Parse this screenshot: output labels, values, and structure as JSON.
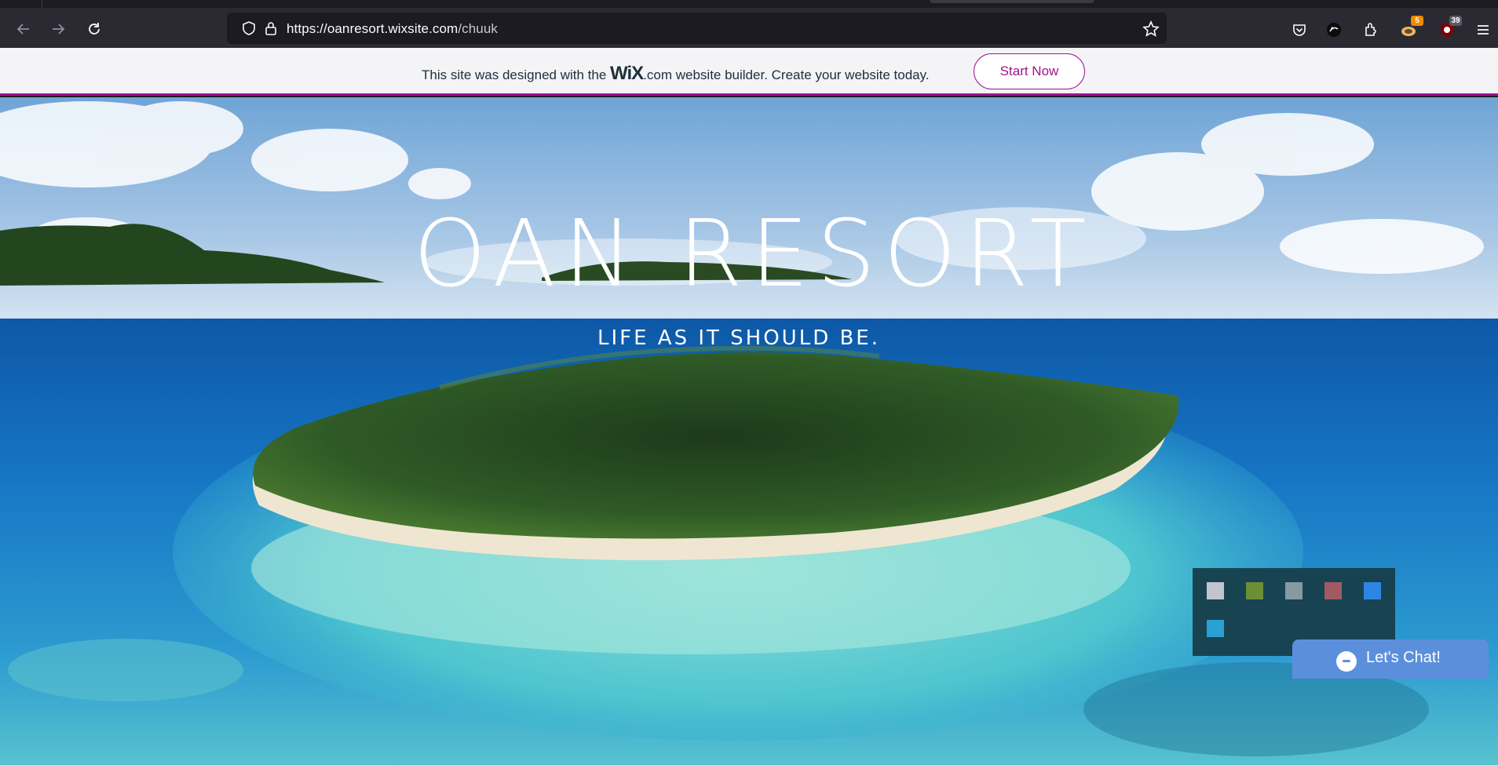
{
  "browser": {
    "url_host": "https://oanresort.wixsite.com",
    "url_path": "/chuuk",
    "badges": {
      "extension_a": "5",
      "extension_b": "39"
    },
    "icons": [
      "back-icon",
      "forward-icon",
      "reload-icon",
      "shield-icon",
      "lock-icon",
      "bookmark-star-icon",
      "pocket-icon",
      "account-icon",
      "extensions-icon",
      "extension-a-icon",
      "extension-b-icon",
      "menu-icon"
    ]
  },
  "wix_banner": {
    "text_before": "This site was designed with the",
    "logo": "WiX",
    "logo_suffix": ".com",
    "text_after": "website builder. Create your website today.",
    "cta_label": "Start Now",
    "accent_color": "#a0138e"
  },
  "hero": {
    "title": "OAN RESORT",
    "subtitle": "LIFE AS IT SHOULD BE."
  },
  "chat": {
    "label": "Let's Chat!"
  }
}
